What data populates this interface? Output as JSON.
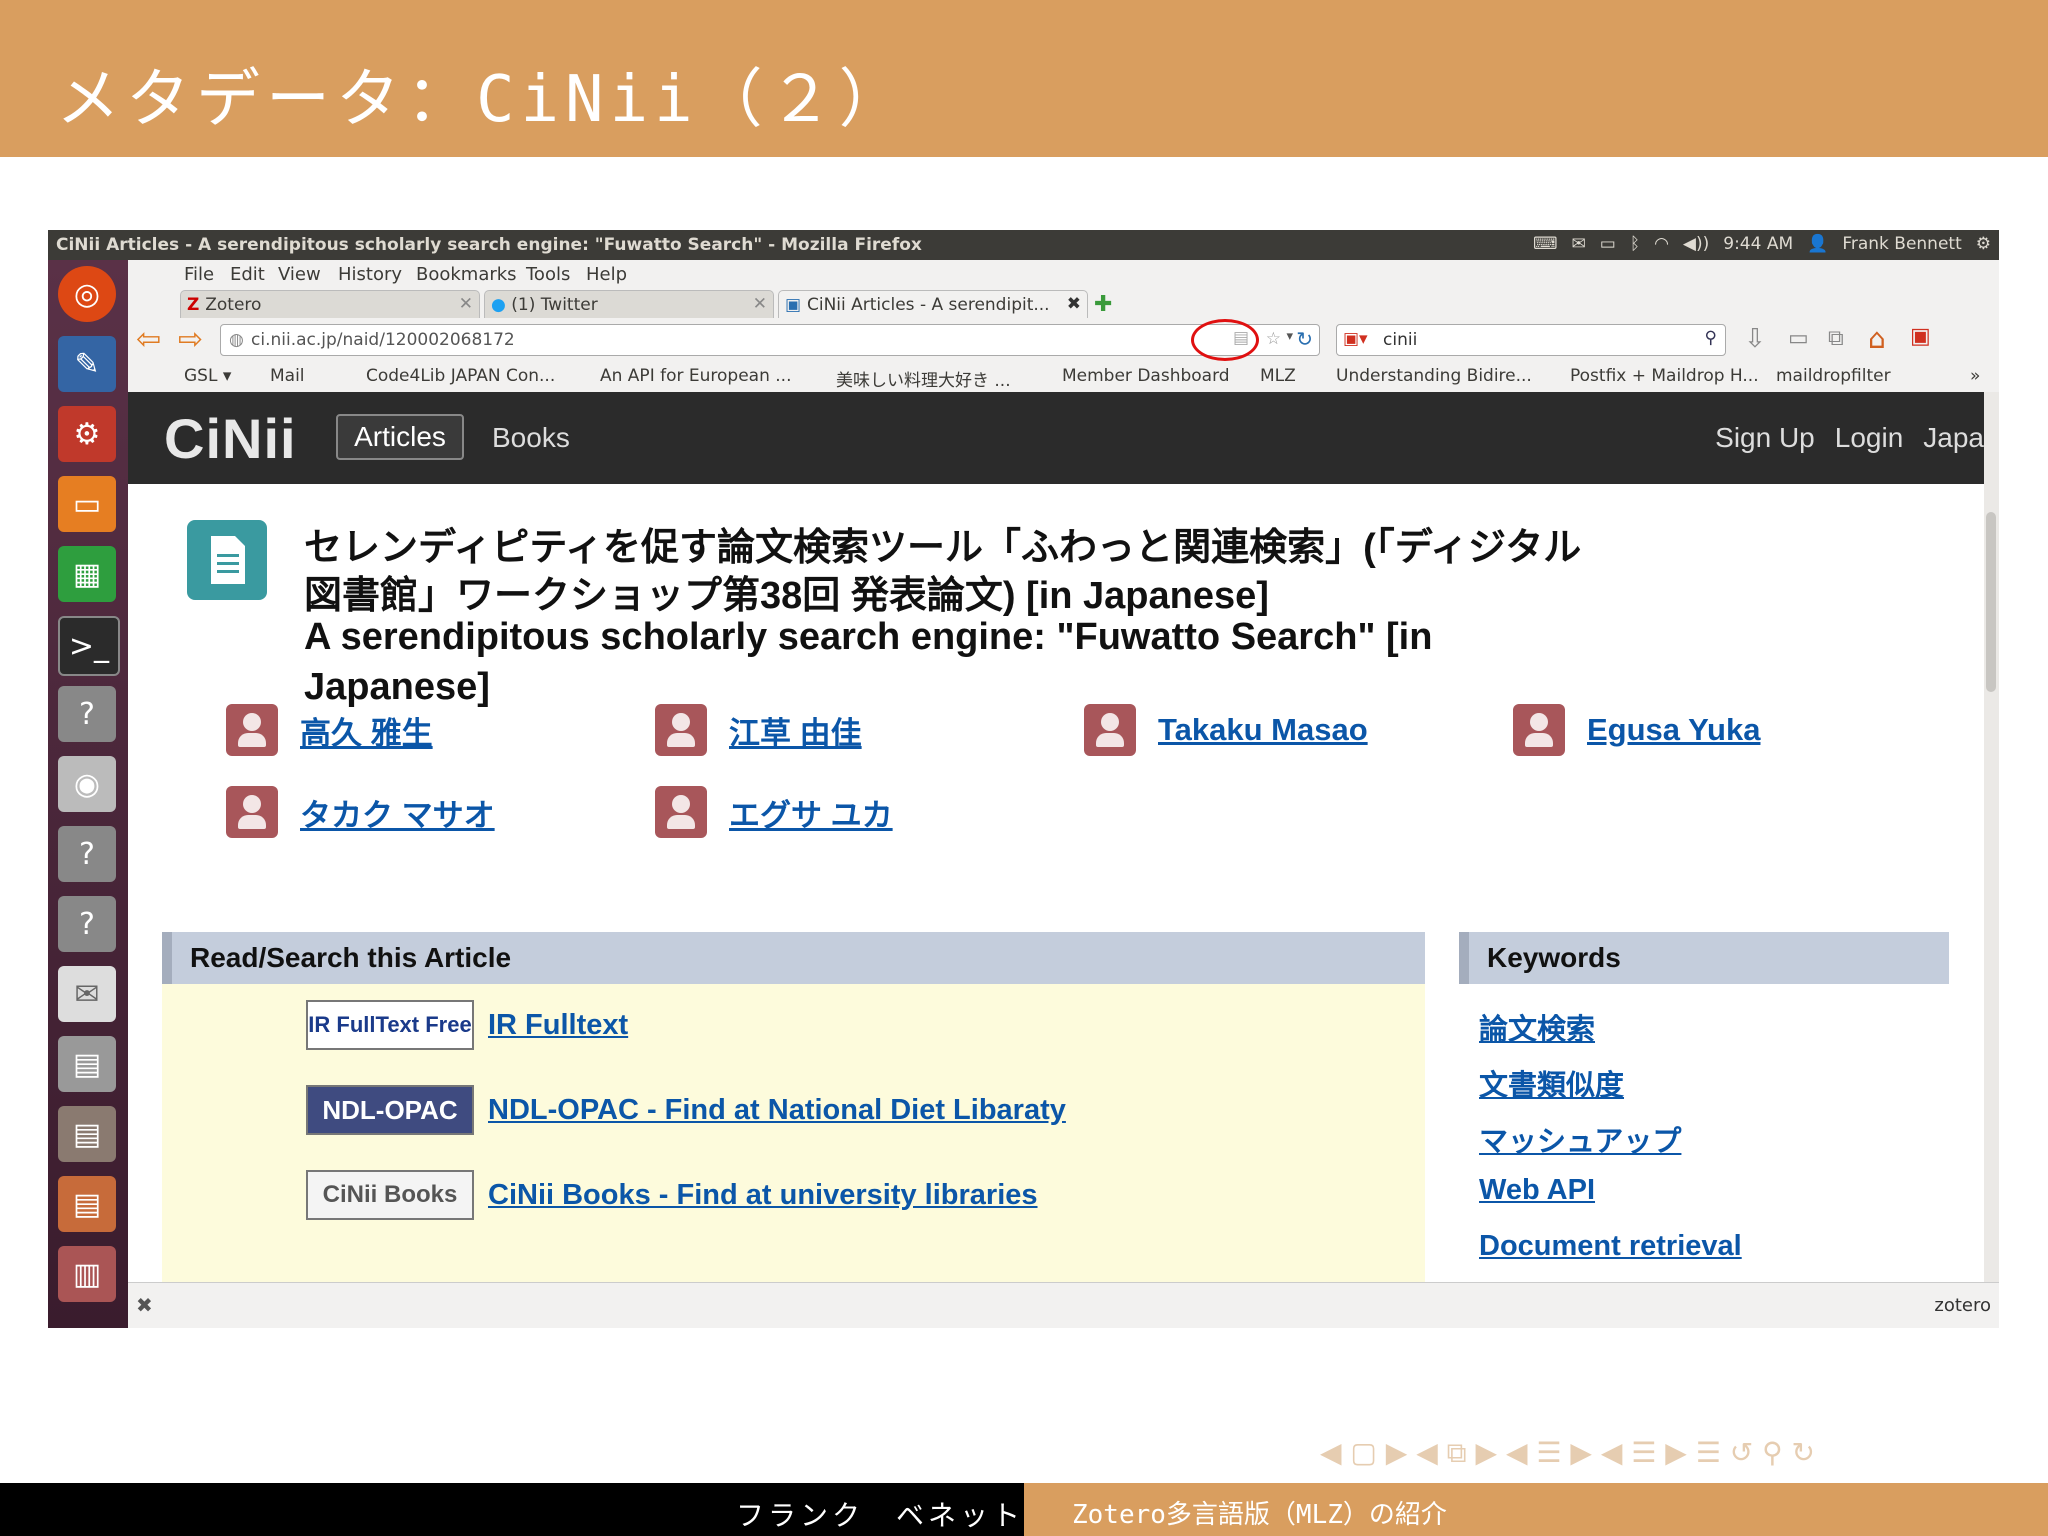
{
  "slide": {
    "title": "メタデータ：CiNii（２）",
    "footer_author": "フランク　ベネット",
    "footer_title": "Zotero多言語版（MLZ）の紹介",
    "nav_symbols": "◀ ▢ ▶  ◀ ⧉ ▶  ◀ ☰ ▶  ◀ ☰ ▶   ☰   ↺ ⚲ ↻"
  },
  "desktop": {
    "window_title": "CiNii Articles -  A serendipitous scholarly search engine: \"Fuwatto Search\" - Mozilla Firefox",
    "clock": "9:44 AM",
    "user": "Frank Bennett",
    "launcher_icons": [
      "ubuntu-icon",
      "text-editor-icon",
      "settings-icon",
      "folder-icon",
      "spreadsheet-icon",
      "terminal-icon",
      "unknown-app-icon",
      "news-icon",
      "unknown-app-icon",
      "unknown-app-icon",
      "mail-icon",
      "workspace-icon"
    ]
  },
  "firefox": {
    "menu": [
      "File",
      "Edit",
      "View",
      "History",
      "Bookmarks",
      "Tools",
      "Help"
    ],
    "tabs": [
      {
        "label": "Zotero"
      },
      {
        "label": "(1) Twitter"
      },
      {
        "label": "CiNii Articles - A serendipit..."
      }
    ],
    "url": "ci.nii.ac.jp/naid/120002068172",
    "search_engine_query": "cinii",
    "bookmarks": [
      "GSL ▾",
      "Mail",
      "Code4Lib JAPAN Con...",
      "An API for European ...",
      "美味しい料理大好き ...",
      "Member Dashboard",
      "MLZ",
      "Understanding Bidire...",
      "Postfix + Maildrop H...",
      "maildropfilter",
      "»"
    ],
    "status_right": "zotero"
  },
  "cinii": {
    "logo": "CiNii",
    "nav_articles": "Articles",
    "nav_books": "Books",
    "nav_signup": "Sign Up",
    "nav_login": "Login",
    "nav_lang": "Japa",
    "title_ja_line1": "セレンディピティを促す論文検索ツール「ふわっと関連検索」(「ディジタル",
    "title_ja_line2": "図書館」ワークショップ第38回 発表論文)  [in Japanese]",
    "title_en_line1": "A serendipitous scholarly search engine: \"Fuwatto Search\"  [in",
    "title_en_line2": "Japanese]",
    "authors": [
      "高久 雅生",
      "江草 由佳",
      "Takaku Masao",
      "Egusa Yuka",
      "タカク マサオ",
      "エグサ ユカ"
    ],
    "read_heading": "Read/Search this Article",
    "resources": [
      {
        "logo": "IR FullText Free",
        "label": "IR Fulltext"
      },
      {
        "logo": "NDL-OPAC",
        "label": "NDL-OPAC - Find at National Diet Libaraty"
      },
      {
        "logo": "CiNii Books",
        "label": "CiNii Books - Find at university libraries"
      }
    ],
    "keywords_heading": "Keywords",
    "keywords": [
      "論文検索",
      "文書類似度",
      "マッシュアップ",
      "Web API",
      "Document retrieval"
    ]
  }
}
